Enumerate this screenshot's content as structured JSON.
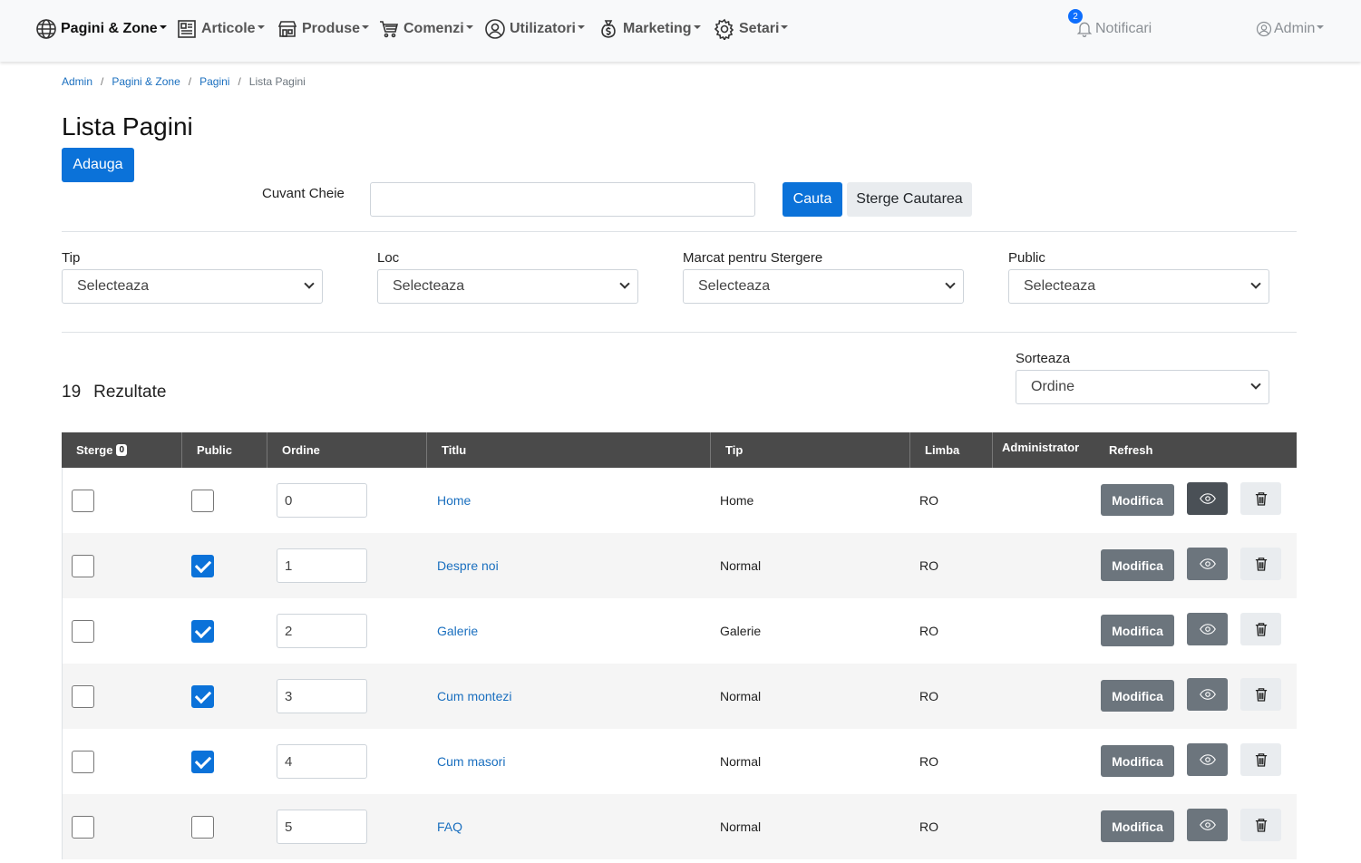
{
  "nav": {
    "items": [
      {
        "label": "Pagini & Zone",
        "icon": "globe-icon"
      },
      {
        "label": "Articole",
        "icon": "newspaper-icon"
      },
      {
        "label": "Produse",
        "icon": "shop-icon"
      },
      {
        "label": "Comenzi",
        "icon": "cart-icon"
      },
      {
        "label": "Utilizatori",
        "icon": "user-circle-icon"
      },
      {
        "label": "Marketing",
        "icon": "money-bag-icon"
      },
      {
        "label": "Setari",
        "icon": "gear-icon"
      }
    ],
    "notifications_label": "Notificari",
    "notifications_count": "2",
    "admin_label": "Admin"
  },
  "breadcrumb": {
    "items": [
      "Admin",
      "Pagini & Zone",
      "Pagini"
    ],
    "current": "Lista Pagini"
  },
  "page": {
    "title": "Lista Pagini",
    "add_button": "Adauga"
  },
  "search": {
    "label": "Cuvant Cheie",
    "value": "",
    "search_button": "Cauta",
    "clear_button": "Sterge Cautarea"
  },
  "filters": {
    "tip": {
      "label": "Tip",
      "value": "Selecteaza"
    },
    "loc": {
      "label": "Loc",
      "value": "Selecteaza"
    },
    "marcat": {
      "label": "Marcat pentru Stergere",
      "value": "Selecteaza"
    },
    "public": {
      "label": "Public",
      "value": "Selecteaza"
    }
  },
  "results": {
    "count": "19",
    "label": "Rezultate"
  },
  "sort": {
    "label": "Sorteaza",
    "value": "Ordine"
  },
  "table": {
    "headers": {
      "sterge": "Sterge",
      "sterge_count": "0",
      "public": "Public",
      "ordine": "Ordine",
      "titlu": "Titlu",
      "tip": "Tip",
      "limba": "Limba",
      "administrator": "Administrator",
      "refresh": "Refresh"
    },
    "edit_label": "Modifica",
    "rows": [
      {
        "delete": false,
        "public": false,
        "order": "0",
        "title": "Home",
        "type": "Home",
        "lang": "RO"
      },
      {
        "delete": false,
        "public": true,
        "order": "1",
        "title": "Despre noi",
        "type": "Normal",
        "lang": "RO"
      },
      {
        "delete": false,
        "public": true,
        "order": "2",
        "title": "Galerie",
        "type": "Galerie",
        "lang": "RO"
      },
      {
        "delete": false,
        "public": true,
        "order": "3",
        "title": "Cum montezi",
        "type": "Normal",
        "lang": "RO"
      },
      {
        "delete": false,
        "public": true,
        "order": "4",
        "title": "Cum masori",
        "type": "Normal",
        "lang": "RO"
      },
      {
        "delete": false,
        "public": false,
        "order": "5",
        "title": "FAQ",
        "type": "Normal",
        "lang": "RO"
      }
    ]
  },
  "colors": {
    "primary": "#0b72d9",
    "table_header": "#4a4a4a",
    "secondary": "#6c757d"
  }
}
